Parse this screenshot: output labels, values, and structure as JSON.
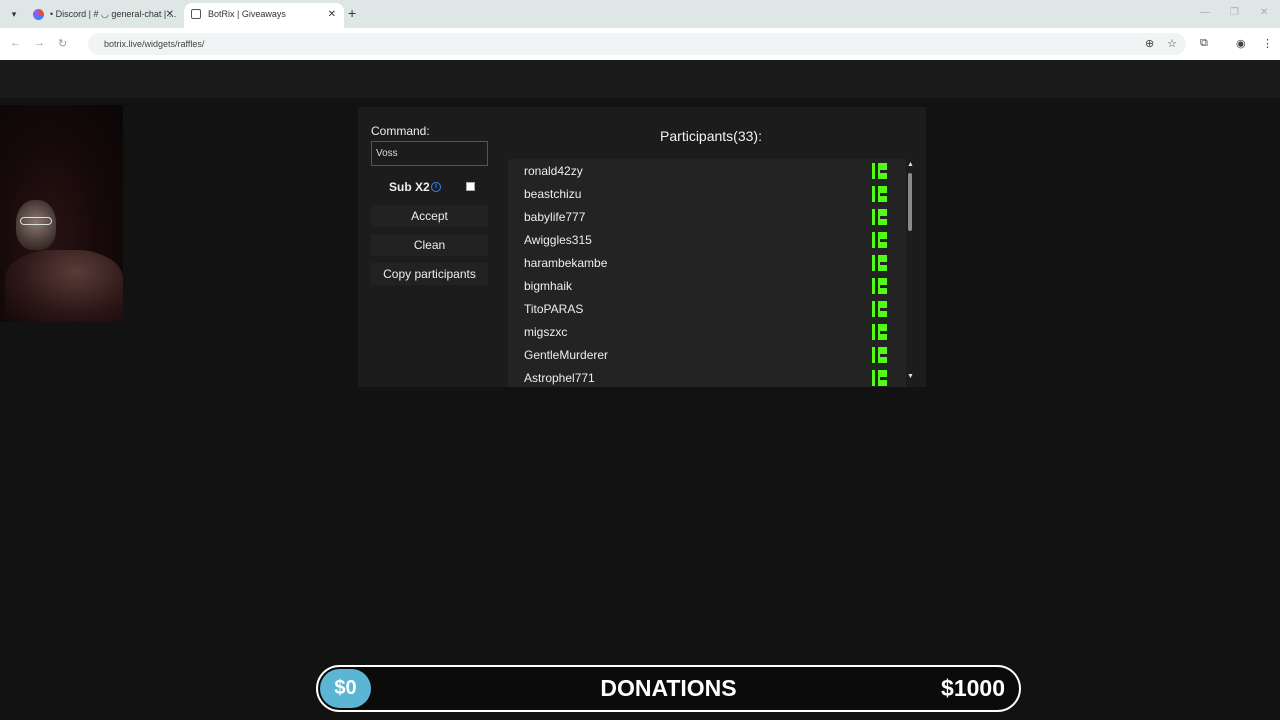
{
  "browser": {
    "tabs": [
      {
        "label": "• Discord | # ◡ general-chat | ..."
      },
      {
        "label": "BotRix | Giveaways"
      }
    ],
    "url": "botrix.live/widgets/raffles/"
  },
  "raffle": {
    "command_label": "Command:",
    "command_value": "Voss",
    "sub_label": "Sub X2",
    "sub_checked": false,
    "accept_label": "Accept",
    "clean_label": "Clean",
    "copy_label": "Copy participants",
    "participants_title": "Participants(33):",
    "participants": [
      "ronald42zy",
      "beastchizu",
      "babylife777",
      "Awiggles315",
      "harambekambe",
      "bigmhaik",
      "TitoPARAS",
      "migszxc",
      "GentleMurderer",
      "Astrophel771"
    ],
    "platform_icon": "kick-icon",
    "platform_color": "#53fc18"
  },
  "donations": {
    "current": "$0",
    "title": "DONATIONS",
    "goal": "$1000",
    "progress": 0,
    "accent": "#5bb6d4"
  }
}
